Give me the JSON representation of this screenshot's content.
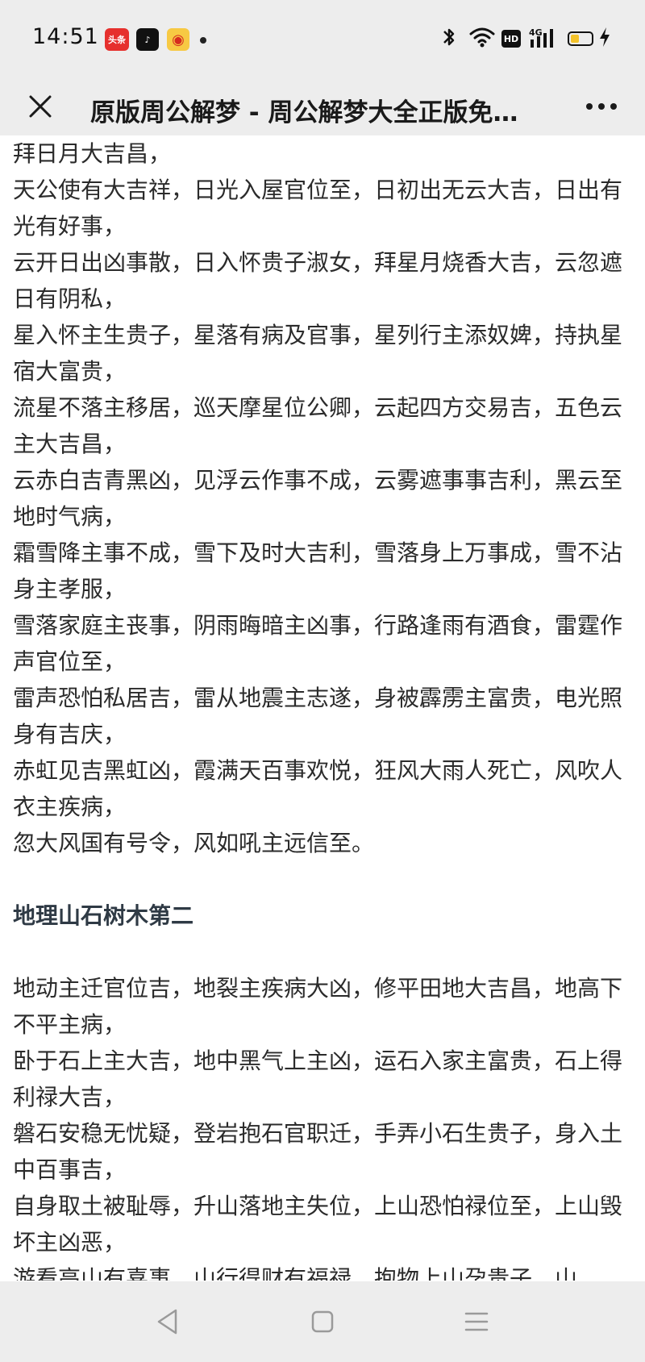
{
  "status_bar": {
    "time": "14:51",
    "apps": [
      {
        "name": "toutiao-icon",
        "label": "头条"
      },
      {
        "name": "douyin-icon",
        "label": "♪"
      },
      {
        "name": "weibo-icon",
        "label": "◉"
      }
    ],
    "network_label": "4G",
    "hd_label": "HD",
    "battery_color": "#f3c22a"
  },
  "title_bar": {
    "title": "原版周公解梦 - 周公解梦大全正版免…"
  },
  "content": {
    "paragraphs_top": [
      "拜日月大吉昌，",
      "天公使有大吉祥，日光入屋官位至，日初出无云大吉，日出有光有好事，",
      "云开日出凶事散，日入怀贵子淑女，拜星月烧香大吉，云忽遮日有阴私，",
      "星入怀主生贵子，星落有病及官事，星列行主添奴婢，持执星宿大富贵，",
      "流星不落主移居，巡天摩星位公卿，云起四方交易吉，五色云主大吉昌，",
      "云赤白吉青黑凶，见浮云作事不成，云雾遮事事吉利，黑云至地时气病，",
      "霜雪降主事不成，雪下及时大吉利，雪落身上万事成，雪不沾身主孝服，",
      "雪落家庭主丧事，阴雨晦暗主凶事，行路逢雨有酒食，雷霆作声官位至，",
      "雷声恐怕私居吉，雷从地震主志遂，身被霹雳主富贵，电光照身有吉庆，",
      "赤虹见吉黑虹凶，霞满天百事欢悦，狂风大雨人死亡，风吹人衣主疾病，",
      "忽大风国有号令，风如吼主远信至。"
    ],
    "section_heading": "地理山石树木第二",
    "paragraphs_bottom": [
      "地动主迁官位吉，地裂主疾病大凶，修平田地大吉昌，地高下不平主病，",
      "卧于石上主大吉，地中黑气上主凶，运石入家主富贵，石上得利禄大吉，",
      "磐石安稳无忧疑，登岩抱石官职迁，手弄小石生贵子，身入土中百事吉，",
      "自身取土被耻辱，升山落地主失位，上山恐怕禄位至，上山毁坏主凶恶，",
      "游看高山有喜事，山行得财有福禄，抱物上山孕贵子，山"
    ]
  }
}
